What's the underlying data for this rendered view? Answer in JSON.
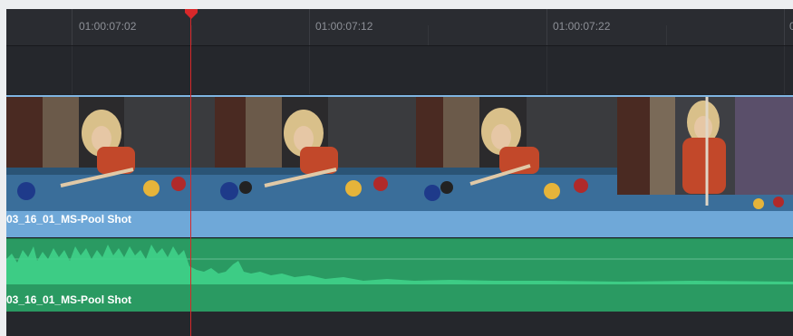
{
  "timeline": {
    "ruler": {
      "timecodes": [
        "01:00:07:02",
        "01:00:07:12",
        "01:00:07:22",
        "0"
      ]
    },
    "video_track": {
      "clip_name": "03_16_01_MS-Pool Shot",
      "thumbnail_count": 4
    },
    "audio_track": {
      "clip_name": "03_16_01_MS-Pool Shot"
    },
    "playhead": {
      "timecode_near": "01:00:07:06"
    }
  },
  "colors": {
    "video_clip": "#6fa8d8",
    "audio_clip": "#2a9a62",
    "waveform": "#3fd18a",
    "playhead": "#d8282a",
    "background": "#1f2126"
  },
  "icons": {
    "playhead": "playhead-marker-icon"
  }
}
